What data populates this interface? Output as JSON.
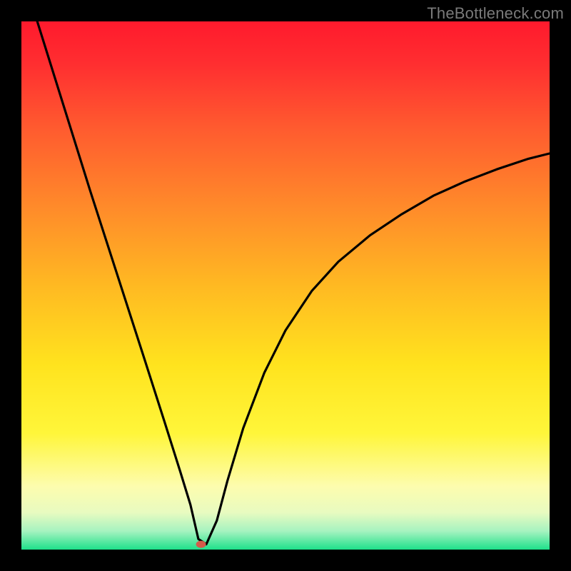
{
  "watermark": "TheBottleneck.com",
  "chart_data": {
    "type": "line",
    "title": "",
    "xlabel": "",
    "ylabel": "",
    "xlim": [
      0,
      100
    ],
    "ylim": [
      0,
      100
    ],
    "grid": false,
    "legend": false,
    "background": {
      "stops": [
        {
          "pct": 0.0,
          "color": "#ff1a2d"
        },
        {
          "pct": 0.08,
          "color": "#ff2e30"
        },
        {
          "pct": 0.2,
          "color": "#ff5a2f"
        },
        {
          "pct": 0.35,
          "color": "#ff8a2a"
        },
        {
          "pct": 0.5,
          "color": "#ffb922"
        },
        {
          "pct": 0.65,
          "color": "#ffe31e"
        },
        {
          "pct": 0.78,
          "color": "#fff63a"
        },
        {
          "pct": 0.88,
          "color": "#fdfcae"
        },
        {
          "pct": 0.93,
          "color": "#e8fbc0"
        },
        {
          "pct": 0.965,
          "color": "#a6f3c0"
        },
        {
          "pct": 1.0,
          "color": "#1ee08a"
        }
      ]
    },
    "marker": {
      "x": 34.0,
      "y": 1.0,
      "color": "#d45a4a",
      "r": 1.0
    },
    "series": [
      {
        "name": "curve",
        "x": [
          3.0,
          8.0,
          13.0,
          18.0,
          23.0,
          27.0,
          30.0,
          32.0,
          33.5,
          35.0,
          37.0,
          39.0,
          42.0,
          46.0,
          50.0,
          55.0,
          60.0,
          66.0,
          72.0,
          78.0,
          84.0,
          90.0,
          96.0,
          100.0
        ],
        "y": [
          100.0,
          84.0,
          68.0,
          52.5,
          37.0,
          24.5,
          15.0,
          8.5,
          2.0,
          1.0,
          5.5,
          13.0,
          23.0,
          33.5,
          41.5,
          49.0,
          54.5,
          59.5,
          63.5,
          67.0,
          69.7,
          72.0,
          74.0,
          75.0
        ]
      }
    ]
  }
}
